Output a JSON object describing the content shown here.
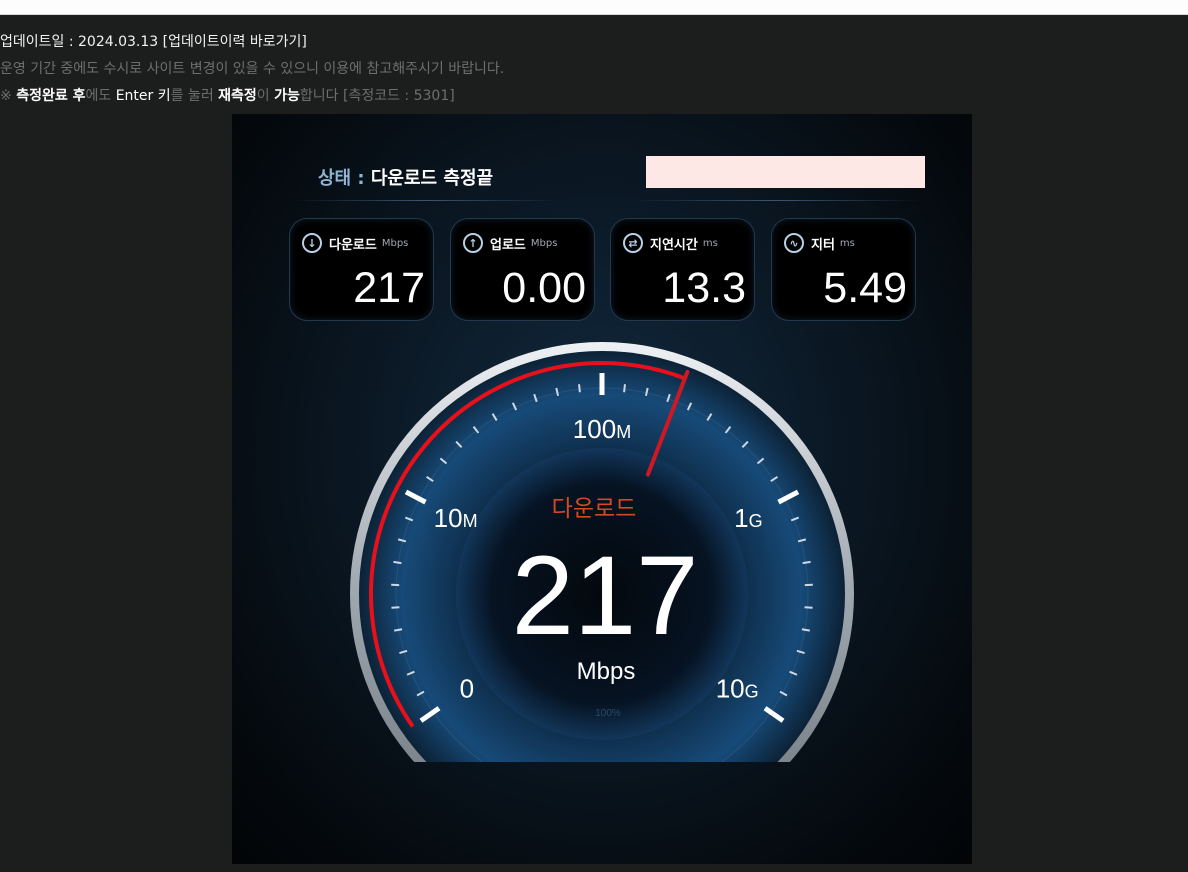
{
  "notice": {
    "updated": "업데이트일 : 2024.03.13 [업데이트이력 바로가기]",
    "line2": "운영 기간 중에도 수시로 사이트 변경이 있을 수 있으니 이용에 참고해주시기 바랍니다.",
    "line3": {
      "mark": "※",
      "p1": "측정완료 후",
      "p2": "에도 ",
      "p3": "Enter 키",
      "p4": "를 눌러 ",
      "p5": "재측정",
      "p6": "이 ",
      "p7": "가능",
      "p8": "합니다 [측정코드 : 5301]"
    }
  },
  "status": {
    "label": "상태 :",
    "value": "다운로드 측정끝"
  },
  "stats": [
    {
      "icon": "download-circle-icon",
      "glyph": "↓",
      "label": "다운로드",
      "unit": "Mbps",
      "value": "217"
    },
    {
      "icon": "upload-circle-icon",
      "glyph": "↑",
      "label": "업로드",
      "unit": "Mbps",
      "value": "0.00"
    },
    {
      "icon": "latency-swap-icon",
      "glyph": "⇄",
      "label": "지연시간",
      "unit": "ms",
      "value": "13.3"
    },
    {
      "icon": "jitter-wave-icon",
      "glyph": "∿",
      "label": "지터",
      "unit": "ms",
      "value": "5.49"
    }
  ],
  "gauge": {
    "mode": "다운로드",
    "value": "217",
    "unit": "Mbps",
    "progress": "100%",
    "scale": [
      {
        "main": "0",
        "suffix": ""
      },
      {
        "main": "10",
        "suffix": "M"
      },
      {
        "main": "100",
        "suffix": "M"
      },
      {
        "main": "1",
        "suffix": "G"
      },
      {
        "main": "10",
        "suffix": "G"
      }
    ],
    "needle_value_mbps": 217,
    "colors": {
      "arc": "#e8101a",
      "needle": "#d01822",
      "mode_text": "#d24a24",
      "rim": "#c9ced4"
    }
  }
}
